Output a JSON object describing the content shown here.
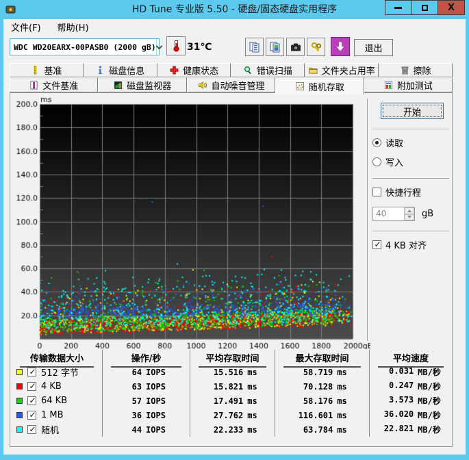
{
  "window": {
    "title": "HD Tune 专业版 5.50 - 硬盘/固态硬盘实用程序"
  },
  "menu": {
    "items": [
      "文件(F)",
      "帮助(H)"
    ]
  },
  "toolbar": {
    "drive_selector": {
      "value": "WDC WD20EARX-00PASB0 (2000 gB)"
    },
    "temperature": "31℃",
    "exit_label": "退出"
  },
  "tabs": {
    "row1": [
      {
        "label": "基准"
      },
      {
        "label": "磁盘信息"
      },
      {
        "label": "健康状态"
      },
      {
        "label": "错误扫描"
      },
      {
        "label": "文件夹占用率"
      },
      {
        "label": "擦除"
      }
    ],
    "row2": [
      {
        "label": "文件基准"
      },
      {
        "label": "磁盘监视器"
      },
      {
        "label": "自动噪音管理"
      },
      {
        "label": "随机存取",
        "active": true
      },
      {
        "label": "附加测试"
      }
    ]
  },
  "controls": {
    "start_label": "开始",
    "read_label": "读取",
    "read_selected": true,
    "write_label": "写入",
    "write_selected": false,
    "short_stroke_label": "快捷行程",
    "short_stroke_checked": false,
    "capacity_value": "40",
    "capacity_unit": "gB",
    "align_label": "4 KB 对齐",
    "align_checked": true
  },
  "table": {
    "columns": [
      "传输数据大小",
      "操作/秒",
      "平均存取时间",
      "最大存取时间",
      "平均速度"
    ],
    "units": {
      "ops": "IOPS",
      "time": "ms",
      "speed": "MB/秒"
    },
    "rows": [
      {
        "color": "#ffff00",
        "checked": true,
        "size": "512 字节",
        "ops": "64",
        "avg": "15.516",
        "max": "58.719",
        "speed": "0.031"
      },
      {
        "color": "#ff0000",
        "checked": true,
        "size": "4 KB",
        "ops": "63",
        "avg": "15.821",
        "max": "70.128",
        "speed": "0.247"
      },
      {
        "color": "#00dd00",
        "checked": true,
        "size": "64 KB",
        "ops": "57",
        "avg": "17.491",
        "max": "58.176",
        "speed": "3.573"
      },
      {
        "color": "#1e5aff",
        "checked": true,
        "size": "1 MB",
        "ops": "36",
        "avg": "27.762",
        "max": "116.601",
        "speed": "36.020"
      },
      {
        "color": "#00ffff",
        "checked": true,
        "size": "随机",
        "ops": "44",
        "avg": "22.233",
        "max": "63.784",
        "speed": "22.821"
      }
    ]
  },
  "chart_data": {
    "type": "scatter",
    "title": "随机存取 access time vs disk position",
    "x_axis": {
      "min": 0,
      "max": 2000,
      "tick_step": 200,
      "unit": "gB"
    },
    "y_axis": {
      "min": 0,
      "max": 200,
      "tick_step": 20,
      "unit": "ms",
      "minor_step": 10
    },
    "style": {
      "bg_top": "#000000",
      "bg_bottom": "#4c4c4c",
      "grid": "#7d7d7d",
      "tick_text": "#000000"
    },
    "series": [
      {
        "name": "512 字节",
        "color": "#ffff00",
        "iops": 64,
        "avg_ms": 15.516,
        "max_ms": 58.719,
        "avg_speed": "0.031 MB/秒",
        "gen": {
          "shape": "low",
          "n": 850,
          "seed": 11,
          "f0": 3.5,
          "f1": 12,
          "band": 12,
          "tail": 28,
          "outliers": [
            [
              980,
              58.7
            ],
            [
              300,
              43
            ],
            [
              1560,
              38
            ]
          ]
        }
      },
      {
        "name": "4 KB",
        "color": "#ff0000",
        "iops": 63,
        "avg_ms": 15.821,
        "max_ms": 70.128,
        "avg_speed": "0.247 MB/秒",
        "gen": {
          "shape": "low",
          "n": 850,
          "seed": 22,
          "f0": 3,
          "f1": 11.5,
          "band": 12,
          "tail": 30,
          "outliers": [
            [
              1485,
              70.1
            ],
            [
              250,
              56
            ],
            [
              1640,
              45
            ]
          ]
        }
      },
      {
        "name": "64 KB",
        "color": "#00dd00",
        "iops": 57,
        "avg_ms": 17.491,
        "max_ms": 58.176,
        "avg_speed": "3.573 MB/秒",
        "gen": {
          "shape": "low",
          "n": 800,
          "seed": 33,
          "f0": 4.5,
          "f1": 13,
          "band": 13,
          "tail": 32,
          "outliers": [
            [
              75,
              52
            ],
            [
              240,
              57
            ],
            [
              1050,
              58.2
            ],
            [
              1770,
              46
            ]
          ]
        }
      },
      {
        "name": "1 MB",
        "color": "#1e5aff",
        "iops": 36,
        "avg_ms": 27.762,
        "max_ms": 116.601,
        "avg_speed": "36.020 MB/秒",
        "gen": {
          "shape": "mid",
          "n": 620,
          "seed": 44,
          "b0": 21.5,
          "b1": 25.5,
          "band": 9,
          "tail": 22,
          "outliers": [
            [
              720,
              116.6
            ],
            [
              1428,
              113
            ],
            [
              955,
              47
            ],
            [
              1185,
              44
            ],
            [
              330,
              41
            ],
            [
              1650,
              43
            ]
          ]
        }
      },
      {
        "name": "随机",
        "color": "#00ffff",
        "iops": 44,
        "avg_ms": 22.233,
        "max_ms": 63.784,
        "avg_speed": "22.821 MB/秒",
        "gen": {
          "shape": "wide",
          "n": 640,
          "seed": 55,
          "f0": 7,
          "f1": 13,
          "band": 10,
          "tail": 38,
          "outliers": [
            [
              880,
              63.8
            ],
            [
              420,
              58
            ],
            [
              1500,
              52
            ]
          ]
        }
      }
    ]
  }
}
